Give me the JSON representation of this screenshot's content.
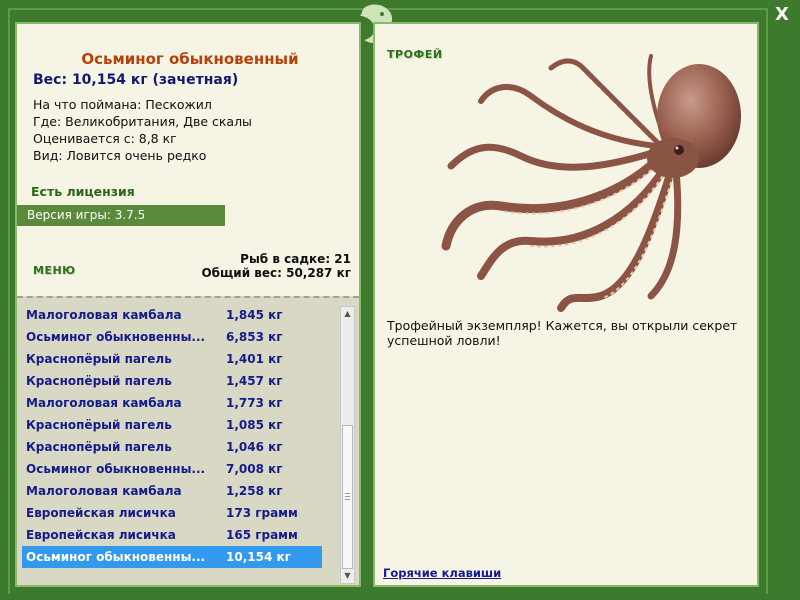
{
  "fish_card": {
    "title": "Осьминог обыкновенный",
    "weight": "Вес: 10,154 кг (зачетная)",
    "caught_with": "На что поймана: Пескожил",
    "location": "Где: Великобритания, Две скалы",
    "valued_from": "Оценивается с: 8,8 кг",
    "kind": "Вид: Ловится очень редко"
  },
  "license_text": "Есть лицензия",
  "version_text": "Версия игры: 3.7.5",
  "menu_label": "МЕНЮ",
  "net": {
    "count": "Рыб в садке: 21",
    "total_weight": "Общий вес: 50,287 кг"
  },
  "catch_list": [
    {
      "name": "Малоголовая камбала",
      "weight": "1,845 кг"
    },
    {
      "name": "Осьминог обыкновенны...",
      "weight": "6,853 кг"
    },
    {
      "name": "Краснопёрый пагель",
      "weight": "1,401 кг"
    },
    {
      "name": "Краснопёрый пагель",
      "weight": "1,457 кг"
    },
    {
      "name": "Малоголовая камбала",
      "weight": "1,773 кг"
    },
    {
      "name": "Краснопёрый пагель",
      "weight": "1,085 кг"
    },
    {
      "name": "Краснопёрый пагель",
      "weight": "1,046 кг"
    },
    {
      "name": "Осьминог обыкновенны...",
      "weight": "7,008 кг"
    },
    {
      "name": "Малоголовая камбала",
      "weight": "1,258 кг"
    },
    {
      "name": "Европейская лисичка",
      "weight": "173 грамм"
    },
    {
      "name": "Европейская лисичка",
      "weight": "165 грамм"
    },
    {
      "name": "Осьминог обыкновенны...",
      "weight": "10,154 кг"
    }
  ],
  "selected_index": 11,
  "trophy_label": "ТРОФЕЙ",
  "trophy_text": "Трофейный экземпляр! Кажется, вы открыли секрет успешной ловли!",
  "hotkeys_label": "Горячие клавиши",
  "close_label": "X",
  "colors": {
    "frame": "#3e7a2e",
    "panel": "#f6f4e4",
    "title": "#b8400a",
    "list_text": "#141c8c",
    "selection": "#3399ee",
    "version_bar": "#5a8a3a"
  },
  "icons": [
    "logo-icon",
    "close-icon",
    "scroll-up-icon",
    "scroll-down-icon",
    "octopus-image"
  ]
}
